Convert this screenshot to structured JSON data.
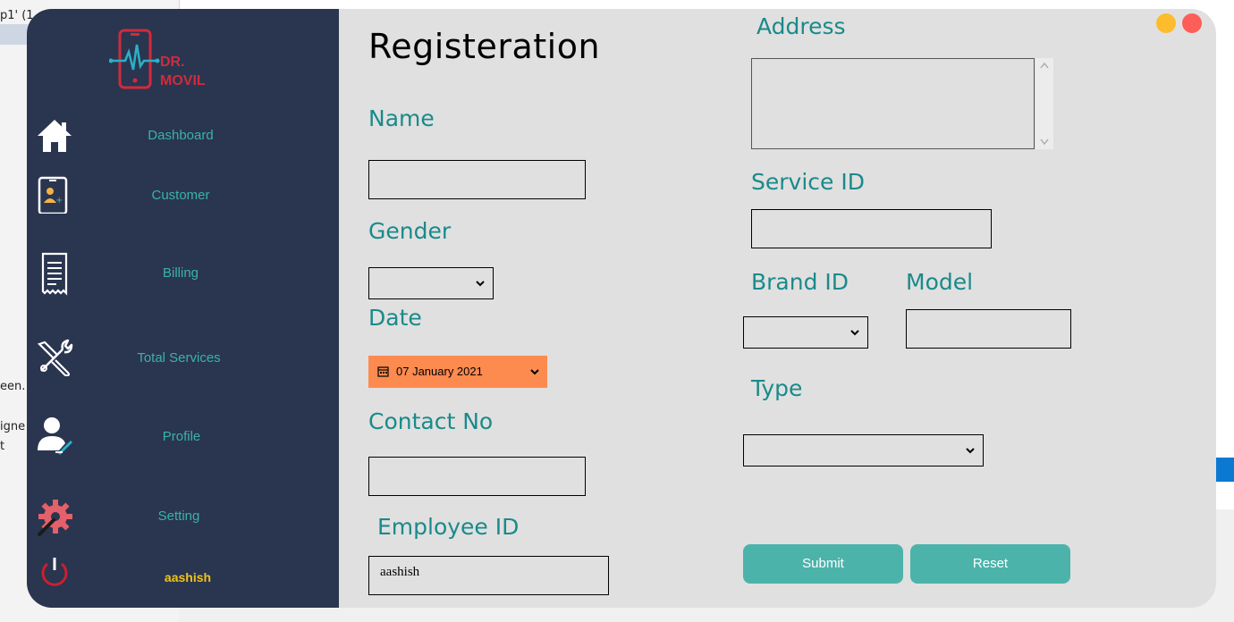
{
  "background": {
    "fragments": [
      "p1' (1",
      "een.",
      "igne",
      "t"
    ]
  },
  "app": {
    "logo_text_1": "DR.",
    "logo_text_2": "MOVIL",
    "nav": [
      {
        "label": "Dashboard",
        "icon": "home-icon"
      },
      {
        "label": "Customer",
        "icon": "customer-card-icon"
      },
      {
        "label": "Billing",
        "icon": "receipt-icon"
      },
      {
        "label": "Total Services",
        "icon": "tools-icon"
      },
      {
        "label": "Profile",
        "icon": "profile-icon"
      },
      {
        "label": "Setting",
        "icon": "gear-icon"
      }
    ],
    "user_name": "aashish",
    "colors": {
      "sidebar": "#2a3550",
      "accent": "#39b3a8",
      "date_bg": "#fd8a4f",
      "button": "#4cb3ab",
      "label": "#1a8a8a"
    }
  },
  "form": {
    "title": "Registeration",
    "name_label": "Name",
    "gender_label": "Gender",
    "date_label": "Date",
    "date_value": "07 January 2021",
    "contact_label": "Contact No",
    "employee_label": "Employee ID",
    "employee_value": "aashish",
    "address_label": "Address",
    "service_label": "Service ID",
    "brand_label": "Brand ID",
    "model_label": "Model",
    "type_label": "Type",
    "submit_label": "Submit",
    "reset_label": "Reset"
  }
}
